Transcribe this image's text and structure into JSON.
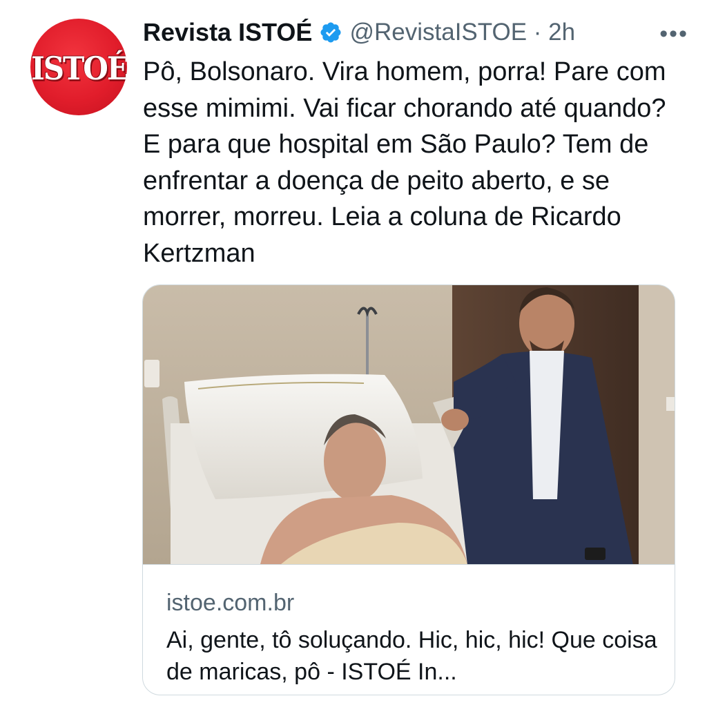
{
  "tweet": {
    "author": {
      "name": "Revista ISTOÉ",
      "handle": "@RevistaISTOE",
      "avatar_text": "ISTOÉ",
      "verified": true
    },
    "time": "2h",
    "handle_time": "@RevistaISTOE · 2h",
    "more_label": "•••",
    "text": "Pô, Bolsonaro. Vira homem, porra! Pare com esse mimimi. Vai ficar chorando até quando? E para que hospital em São Paulo? Tem de enfrentar a doença de peito aberto, e se morrer, morreu. Leia a coluna de Ricardo Kertzman",
    "card": {
      "domain": "istoe.com.br",
      "title": "Ai, gente, tô soluçando. Hic, hic, hic! Que coisa de maricas, pô - ISTOÉ In..."
    }
  },
  "colors": {
    "text": "#0f1419",
    "secondary": "#536471",
    "verified_blue": "#1d9bf0",
    "avatar_red": "#e11d2b",
    "border": "#cfd9de"
  }
}
